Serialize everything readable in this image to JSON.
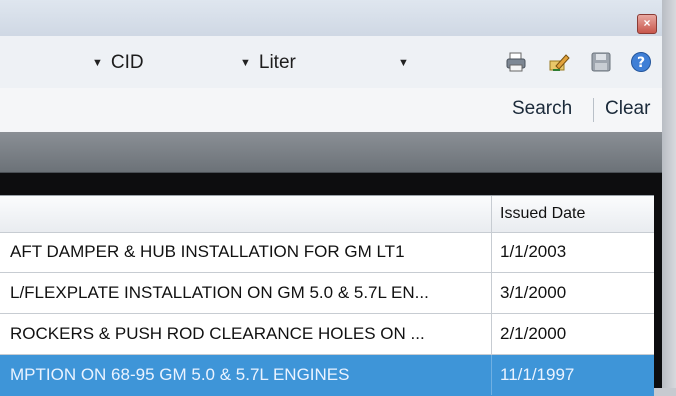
{
  "window": {
    "close_glyph": "×"
  },
  "toolbar": {
    "cid_label": "CID",
    "liter_label": "Liter",
    "third_combo_value": "",
    "arrow_glyph": "▼",
    "icons": [
      "print-icon",
      "edit-icon",
      "save-icon",
      "help-icon"
    ]
  },
  "actions": {
    "search_label": "Search",
    "clear_label": "Clear"
  },
  "grid": {
    "columns": [
      "",
      "Issued Date"
    ],
    "rows": [
      {
        "title": "AFT DAMPER & HUB INSTALLATION FOR GM LT1",
        "issued": "1/1/2003"
      },
      {
        "title": "L/FLEXPLATE INSTALLATION ON GM 5.0 & 5.7L EN...",
        "issued": "3/1/2000"
      },
      {
        "title": "ROCKERS & PUSH ROD CLEARANCE HOLES ON ...",
        "issued": "2/1/2000"
      },
      {
        "title": "MPTION ON 68-95 GM 5.0 & 5.7L ENGINES",
        "issued": "11/1/1997"
      }
    ],
    "selected_row_index": 3,
    "selection_color": "#3e95d8"
  }
}
